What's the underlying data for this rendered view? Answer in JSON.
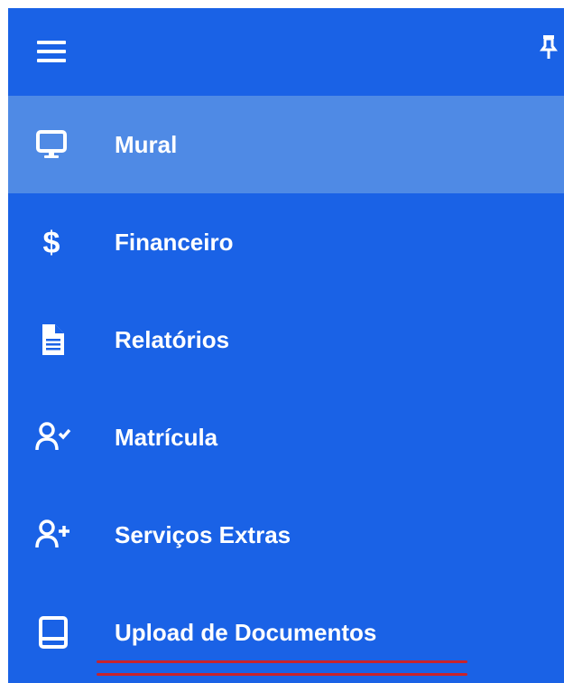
{
  "colors": {
    "sidebar_bg": "#1a62e6",
    "active_bg": "#4f8ae5",
    "text": "#ffffff",
    "annotation_underline": "#c8232c"
  },
  "header": {
    "menu_icon": "hamburger-menu-icon",
    "pin_icon": "pushpin-icon"
  },
  "menu": {
    "items": [
      {
        "label": "Mural",
        "icon": "monitor-icon",
        "active": true
      },
      {
        "label": "Financeiro",
        "icon": "dollar-sign-icon",
        "active": false
      },
      {
        "label": "Relatórios",
        "icon": "document-icon",
        "active": false
      },
      {
        "label": "Matrícula",
        "icon": "user-check-icon",
        "active": false
      },
      {
        "label": "Serviços Extras",
        "icon": "user-plus-icon",
        "active": false
      },
      {
        "label": "Upload de Documentos",
        "icon": "book-icon",
        "active": false
      }
    ]
  }
}
